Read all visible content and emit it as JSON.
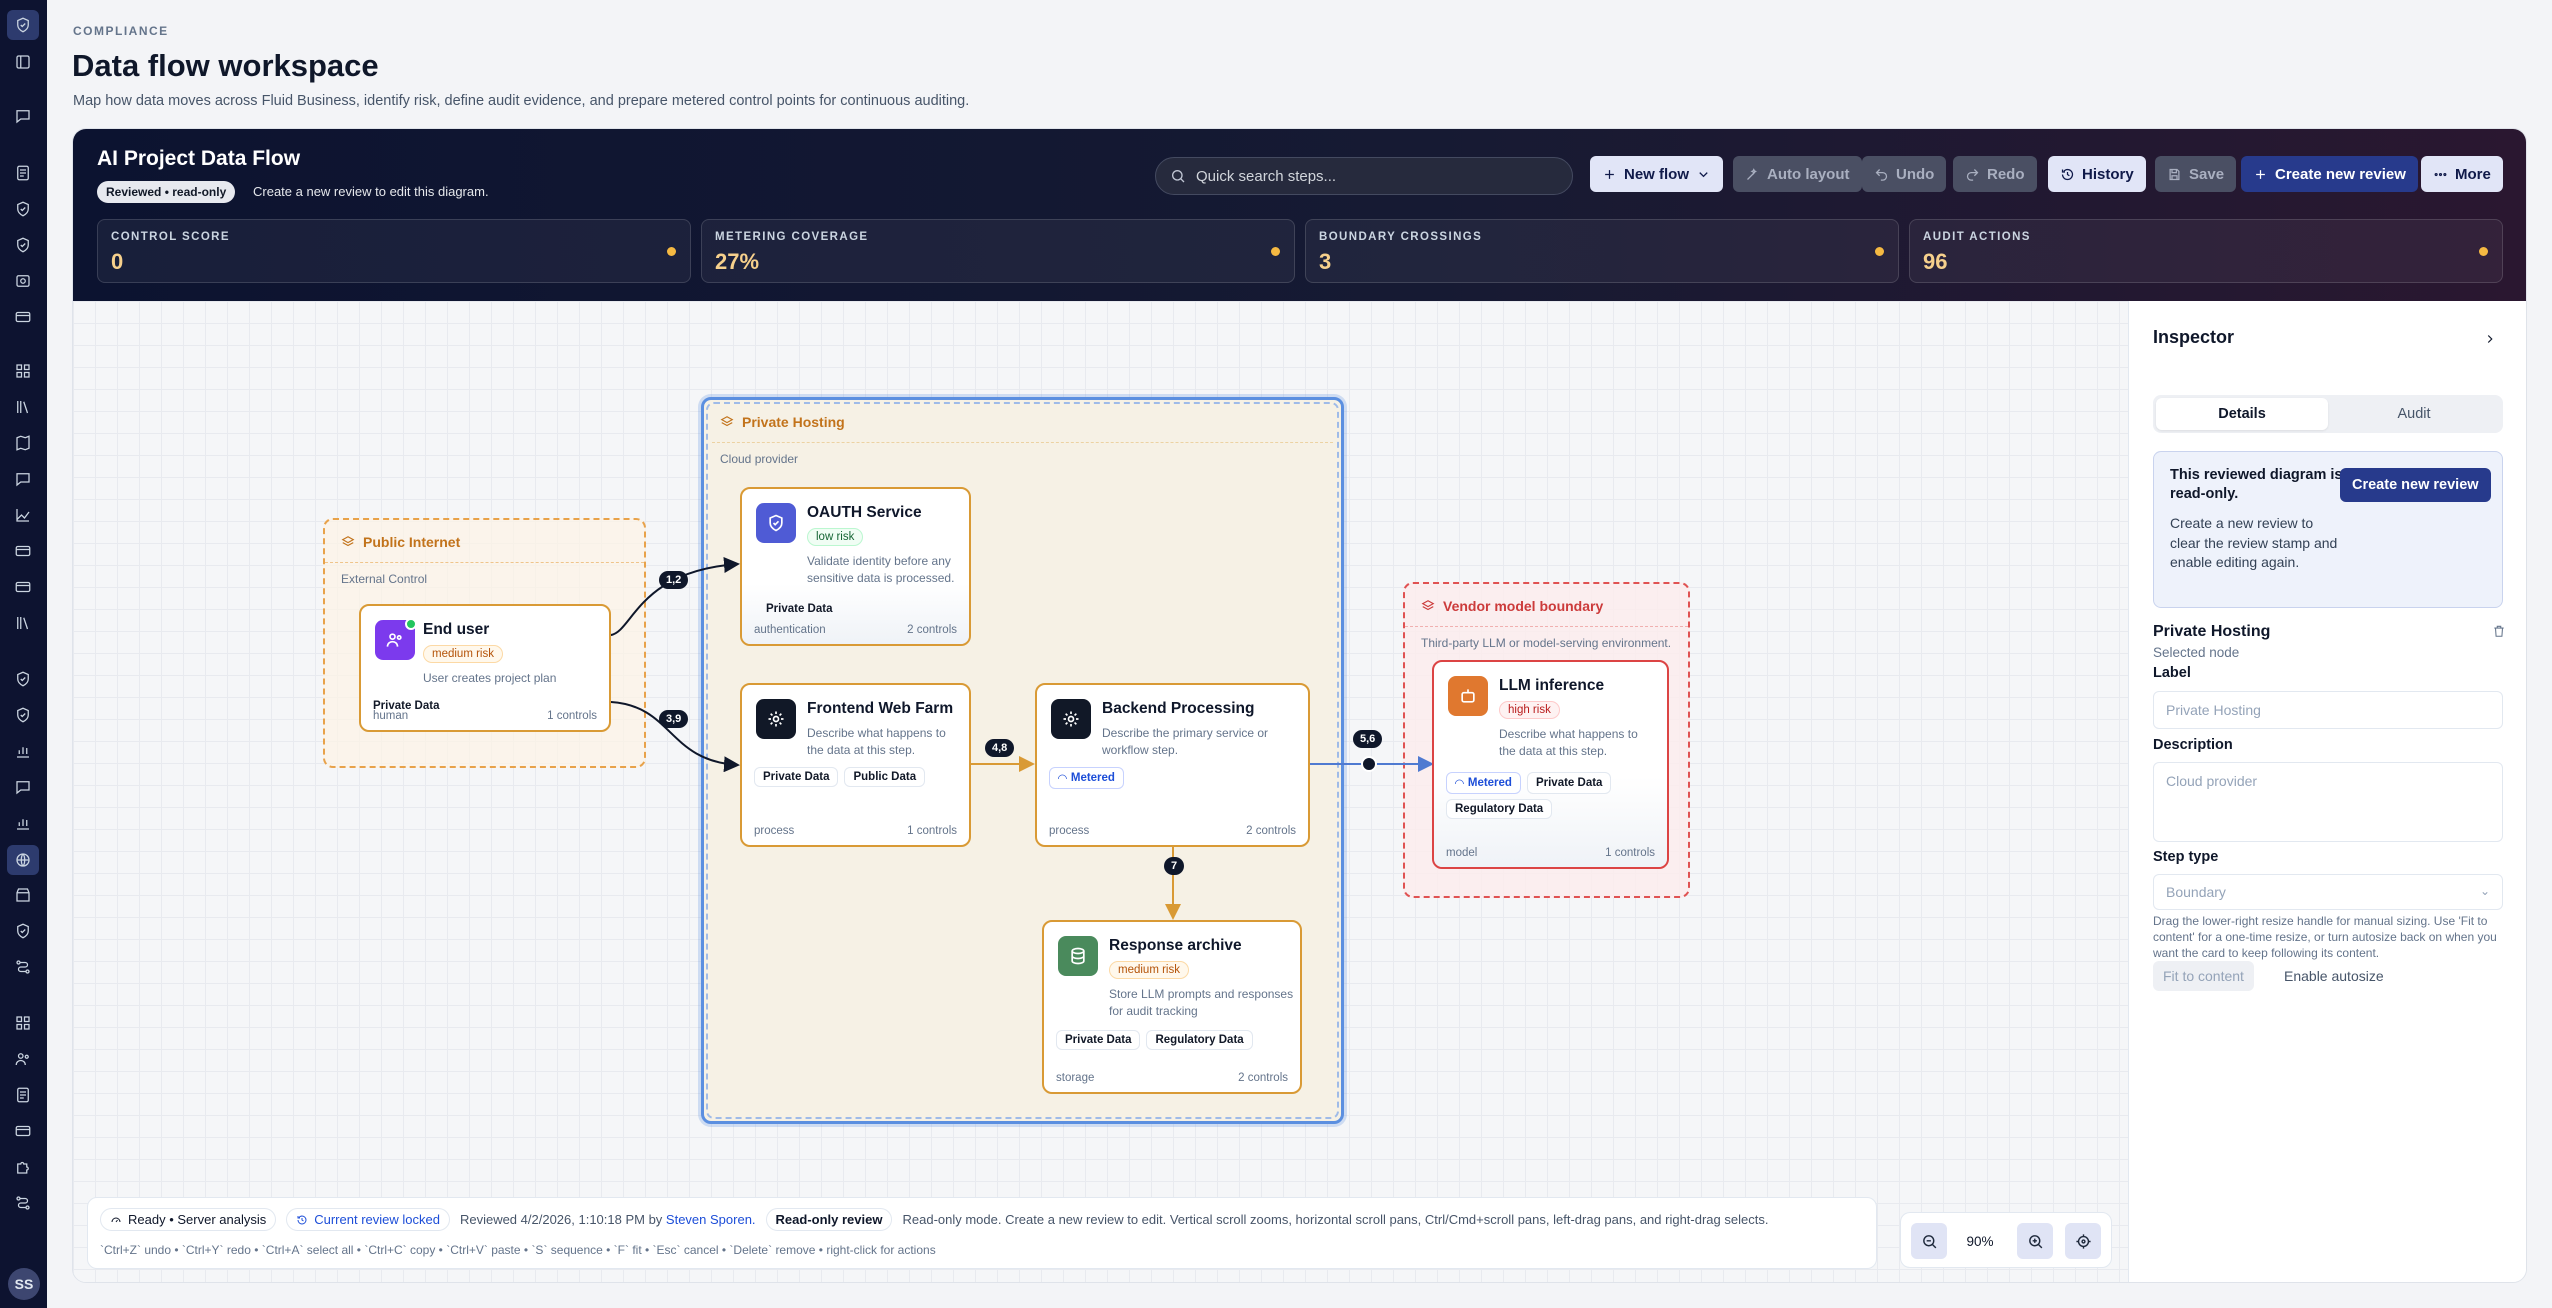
{
  "nav": {
    "icons": [
      "shield-check-icon",
      "book-icon",
      "document-icon",
      "chat-icon",
      "document-icon",
      "shield-icon",
      "shield-icon",
      "camera-icon",
      "card-icon",
      "grid-icon",
      "library-icon",
      "map-book-icon",
      "chat-icon",
      "trend-icon",
      "card-icon",
      "card-icon",
      "library-icon",
      "shield-icon",
      "shield-icon",
      "bar-chart-icon",
      "chat-icon",
      "bar-chart-icon",
      "globe-icon",
      "store-icon",
      "shield-icon",
      "route-icon",
      "grid-icon",
      "users-icon",
      "document-icon",
      "card-icon",
      "puzzle-icon",
      "route-icon",
      "folder-icon"
    ],
    "avatar_initials": "SS"
  },
  "page": {
    "eyebrow": "COMPLIANCE",
    "title": "Data flow workspace",
    "subtitle": "Map how data moves across Fluid Business, identify risk, define audit evidence, and prepare metered control points for continuous auditing."
  },
  "flow": {
    "title": "AI Project Data Flow",
    "status_pill": "Reviewed • read-only",
    "status_note": "Create a new review to edit this diagram.",
    "search_placeholder": "Quick search steps...",
    "toolbar": {
      "new_flow": "New flow",
      "auto_layout": "Auto layout",
      "undo": "Undo",
      "redo": "Redo",
      "history": "History",
      "save": "Save",
      "create_review": "Create new review",
      "more": "More"
    },
    "metrics": [
      {
        "label": "CONTROL SCORE",
        "value": "0"
      },
      {
        "label": "METERING COVERAGE",
        "value": "27%"
      },
      {
        "label": "BOUNDARY CROSSINGS",
        "value": "3"
      },
      {
        "label": "AUDIT ACTIONS",
        "value": "96"
      }
    ],
    "accent_color": "#f5b942"
  },
  "diagram": {
    "zones": {
      "public": {
        "title": "Public Internet",
        "desc": "External Control"
      },
      "private": {
        "title": "Private Hosting",
        "desc": "Cloud provider"
      },
      "vendor": {
        "title": "Vendor model boundary",
        "desc": "Third-party LLM or model-serving environment."
      }
    },
    "nodes": {
      "end_user": {
        "title": "End user",
        "risk": "medium risk",
        "desc": "User creates project plan",
        "tags": [
          "Private Data"
        ],
        "kind": "human",
        "controls": "1 controls"
      },
      "oauth": {
        "title": "OAUTH Service",
        "risk": "low risk",
        "desc": "Validate identity before any sensitive data is processed.",
        "tags": [
          "Private Data"
        ],
        "kind": "authentication",
        "controls": "2 controls"
      },
      "frontend": {
        "title": "Frontend Web Farm",
        "desc": "Describe what happens to the data at this step.",
        "tags": [
          "Private Data",
          "Public Data"
        ],
        "kind": "process",
        "controls": "1 controls"
      },
      "backend": {
        "title": "Backend Processing",
        "desc": "Describe the primary service or workflow step.",
        "tags": [
          "Metered"
        ],
        "kind": "process",
        "controls": "2 controls"
      },
      "archive": {
        "title": "Response archive",
        "risk": "medium risk",
        "desc": "Store LLM prompts and responses for audit tracking",
        "tags": [
          "Private Data",
          "Regulatory Data"
        ],
        "kind": "storage",
        "controls": "2 controls"
      },
      "llm": {
        "title": "LLM inference",
        "risk": "high risk",
        "desc": "Describe what happens to the data at this step.",
        "tags": [
          "Metered",
          "Private Data",
          "Regulatory Data"
        ],
        "kind": "model",
        "controls": "1 controls"
      }
    },
    "edge_labels": {
      "e12": "1,2",
      "e39": "3,9",
      "e48": "4,8",
      "e56": "5,6",
      "e7": "7"
    }
  },
  "inspector": {
    "title": "Inspector",
    "tabs": [
      "Details",
      "Audit"
    ],
    "notice_head": "This reviewed diagram is read-only.",
    "notice_body": "Create a new review to clear the review stamp and enable editing again.",
    "notice_button": "Create new review",
    "selected_name": "Private Hosting",
    "selected_sub": "Selected node",
    "label_label": "Label",
    "label_value": "Private Hosting",
    "desc_label": "Description",
    "desc_value": "Cloud provider",
    "steptype_label": "Step type",
    "steptype_value": "Boundary",
    "help": "Drag the lower-right resize handle for manual sizing. Use 'Fit to content' for a one-time resize, or turn autosize back on when you want the card to keep following its content.",
    "fit_button": "Fit to content",
    "autosize_button": "Enable autosize"
  },
  "status": {
    "ready": "Ready • Server analysis",
    "locked": "Current review locked",
    "reviewed_prefix": "Reviewed 4/2/2026, 1:10:18 PM by ",
    "reviewer": "Steven Sporen.",
    "readonly_chip": "Read-only review",
    "message": "Read-only mode. Create a new review to edit. Vertical scroll zooms, horizontal scroll pans, Ctrl/Cmd+scroll pans, left-drag pans, and right-drag selects.",
    "shortcuts": "`Ctrl+Z` undo • `Ctrl+Y` redo • `Ctrl+A` select all • `Ctrl+C` copy • `Ctrl+V` paste • `S` sequence • `F` fit • `Esc` cancel • `Delete` remove • right-click for actions"
  },
  "zoom": {
    "value": "90%"
  }
}
